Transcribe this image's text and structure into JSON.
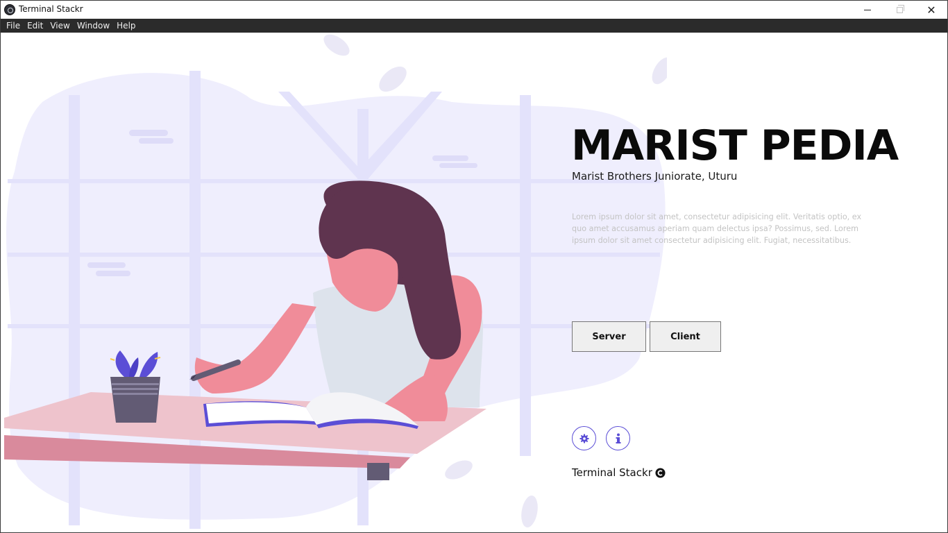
{
  "window": {
    "title": "Terminal Stackr",
    "app_icon": "electron-app-icon",
    "controls": [
      "minimize-icon",
      "maximize-icon",
      "close-icon"
    ]
  },
  "menubar": {
    "items": [
      "File",
      "Edit",
      "View",
      "Window",
      "Help"
    ]
  },
  "hero": {
    "title": "MARIST PEDIA",
    "subtitle": "Marist Brothers Juniorate, Uturu",
    "description": "Lorem ipsum dolor sit amet, consectetur adipisicing elit. Veritatis optio, ex quo amet accusamus aperiam quam delectus ipsa? Possimus, sed. Lorem ipsum dolor sit amet consectetur adipisicing elit. Fugiat, necessitatibus."
  },
  "actions": {
    "server_label": "Server",
    "client_label": "Client"
  },
  "icon_buttons": {
    "settings": "gear-icon",
    "info": "info-icon"
  },
  "footer": {
    "brand": "Terminal Stackr",
    "brand_icon": "copyright-icon"
  },
  "illustration": {
    "description_icon": "woman-writing-at-desk-illustration"
  },
  "colors": {
    "accent": "#5b4ed6",
    "blob": "#efeefd",
    "window_frame": "#e3e2fb",
    "desk": "#eec3cc",
    "desk_edge": "#d98a9c",
    "hair": "#5f344f",
    "skin": "#f08c99",
    "shirt": "#dde3ec",
    "pot": "#625b74",
    "menubar": "#2b2b2b"
  }
}
